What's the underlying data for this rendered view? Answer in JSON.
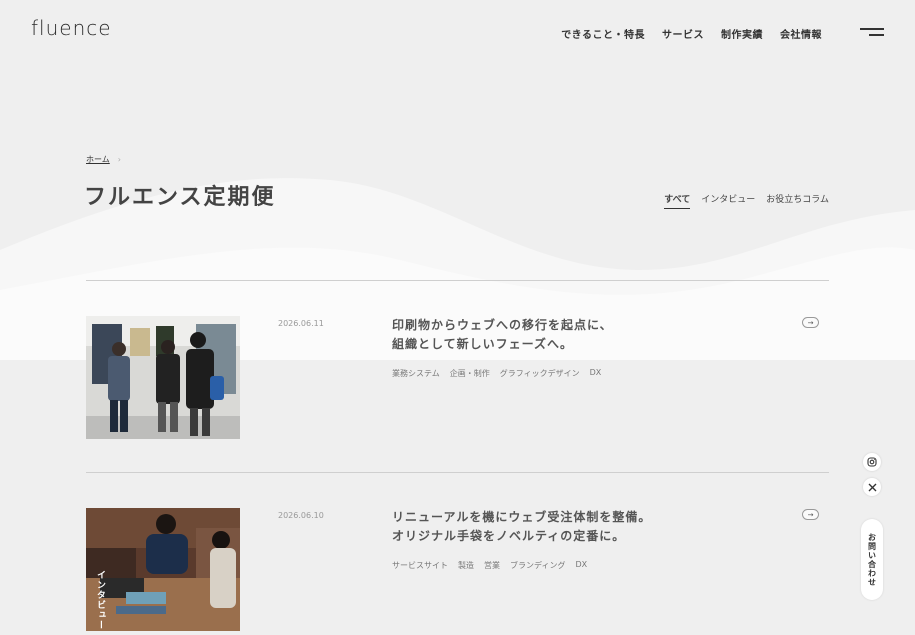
{
  "header": {
    "logo": "fluence",
    "nav": [
      "できること・特長",
      "サービス",
      "制作実績",
      "会社情報"
    ]
  },
  "breadcrumb": {
    "home": "ホーム",
    "separator": "›"
  },
  "page_title": "フルエンス定期便",
  "tabs": [
    {
      "label": "すべて",
      "active": true
    },
    {
      "label": "インタビュー",
      "active": false
    },
    {
      "label": "お役立ちコラム",
      "active": false
    }
  ],
  "articles": [
    {
      "date": "2026.06.11",
      "title_line1": "印刷物からウェブへの移行を起点に、",
      "title_line2": "組織として新しいフェーズへ。",
      "tags": [
        "業務システム",
        "企画・制作",
        "グラフィックデザイン",
        "DX"
      ],
      "arrow": "→"
    },
    {
      "date": "2026.06.10",
      "title_line1": "リニューアルを機にウェブ受注体制を整備。",
      "title_line2": "オリジナル手袋をノベルティの定番に。",
      "tags": [
        "サービスサイト",
        "製造",
        "営業",
        "ブランディング",
        "DX"
      ],
      "thumb_badge": "インタビュー",
      "arrow": "→"
    }
  ],
  "sidebar": {
    "contact": "お問い合わせ"
  },
  "icons": [
    "instagram-icon",
    "x-icon",
    "menu-icon",
    "arrow-right-icon"
  ],
  "colors": {
    "background": "#efefef",
    "text": "#333333",
    "divider": "#cfcfcf"
  }
}
